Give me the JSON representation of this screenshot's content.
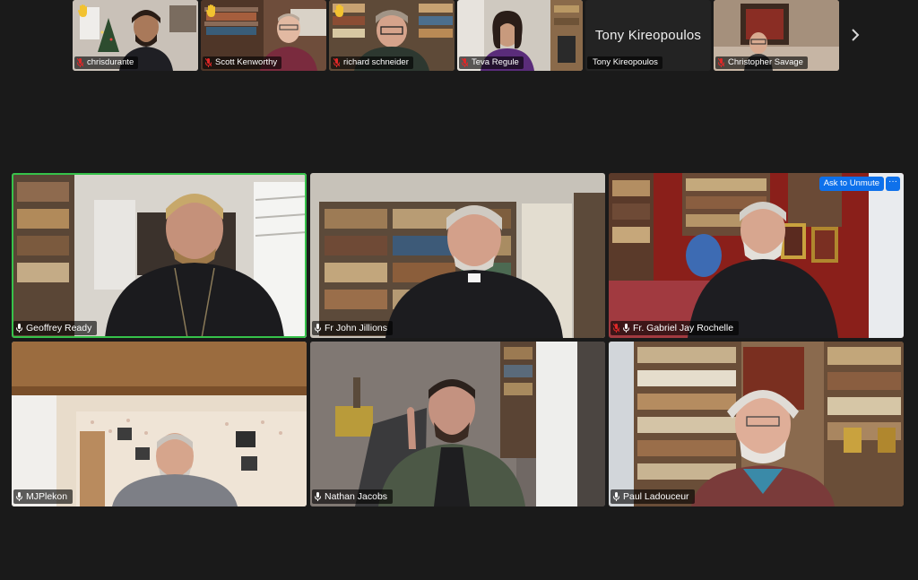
{
  "strip": [
    {
      "name": "chrisdurante",
      "muted": true,
      "hand_raised": true
    },
    {
      "name": "Scott Kenworthy",
      "muted": true,
      "hand_raised": true
    },
    {
      "name": "richard schneider",
      "muted": true,
      "hand_raised": true
    },
    {
      "name": "Teva Regule",
      "muted": true,
      "hand_raised": false
    },
    {
      "name": "Tony Kireopoulos",
      "big_name": "Tony Kireopoulos",
      "video": false,
      "muted": false,
      "hand_raised": false
    },
    {
      "name": "Christopher Savage",
      "muted": true,
      "hand_raised": false
    }
  ],
  "grid": [
    {
      "name": "Geoffrey Ready",
      "muted": false,
      "active_speaker": true
    },
    {
      "name": "Fr John Jillions",
      "muted": false
    },
    {
      "name": "Fr. Gabriel Jay Rochelle",
      "muted": true,
      "ask_to_unmute": "Ask to Unmute",
      "more": "···"
    },
    {
      "name": "MJPlekon",
      "muted": false
    },
    {
      "name": "Nathan Jacobs",
      "muted": false
    },
    {
      "name": "Paul Ladouceur",
      "muted": false
    }
  ],
  "colors": {
    "background": "#1a1a1a",
    "active_border": "#36c24a",
    "muted_red": "#e02828",
    "button_blue": "#0e71eb"
  },
  "icons": {
    "next": "chevron-right-icon",
    "hand": "raised-hand-icon",
    "mic": "microphone-icon",
    "mic_muted": "microphone-muted-icon"
  }
}
